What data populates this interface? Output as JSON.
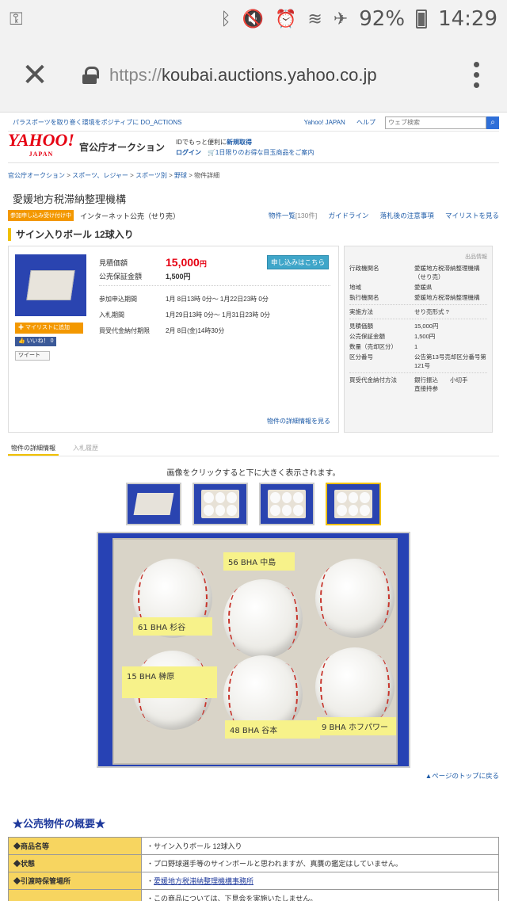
{
  "statusbar": {
    "battery": "92%",
    "time": "14:29",
    "icons": [
      "key-icon",
      "bluetooth-icon",
      "mute-icon",
      "alarm-icon",
      "wifi-icon",
      "airplane-icon",
      "battery-icon"
    ]
  },
  "browser": {
    "url_proto": "https://",
    "url_host": "koubai.auctions.yahoo.co.jp"
  },
  "top": {
    "promo": "パラスポーツを取り巻く環境をポジティブに DO_ACTIONS",
    "yahoo_japan_link": "Yahoo! JAPAN",
    "help_link": "ヘルプ",
    "search_placeholder": "ウェブ検索"
  },
  "header": {
    "logo_main": "YAHOO!",
    "logo_sub": "JAPAN",
    "site_name": "官公庁オークション",
    "msg_line1_prefix": "IDでもっと便利に",
    "msg_line1_link": "新規取得",
    "msg_line2_link": "ログイン",
    "msg_line2_text": "🛒1日限りのお得な目玉商品をご案内"
  },
  "breadcrumb": {
    "items": [
      "官公庁オークション",
      "スポーツ、レジャー",
      "スポーツ別",
      "野球"
    ],
    "current": "物件詳細",
    "sep": " > "
  },
  "org_title": "愛媛地方税滞納整理機構",
  "status": {
    "badge": "参加申し込み受け付け中",
    "type": "インターネット公売（せり売）",
    "links": {
      "list": "物件一覧",
      "list_count": "[130件]",
      "guideline": "ガイドライン",
      "notice": "落札後の注意事項",
      "mylist": "マイリストを見る"
    }
  },
  "item_title": "サイン入りボール 12球入り",
  "left": {
    "mylist_btn": "✚ マイリストに追加",
    "fb_like": "👍 いいね！ 0",
    "tweet": "ツイート",
    "price_label": "見積価額",
    "price_value": "15,000",
    "price_unit": "円",
    "apply_btn": "申し込みはこちら",
    "deposit_label": "公売保証金額",
    "deposit_value": "1,500円",
    "periods": [
      {
        "label": "参加申込期間",
        "value": "1月 8日13時 0分〜 1月22日23時 0分"
      },
      {
        "label": "入札期間",
        "value": "1月29日13時 0分〜 1月31日23時 0分"
      },
      {
        "label": "買受代金納付期限",
        "value": "2月 8日(金)14時30分"
      }
    ],
    "more_link": "物件の詳細情報を見る"
  },
  "right": {
    "caption": "出品情報",
    "rows1": [
      {
        "k": "行政機関名",
        "v": "愛媛地方税滞納整理機構（せり売）"
      },
      {
        "k": "地域",
        "v": "愛媛県"
      },
      {
        "k": "執行機関名",
        "v": "愛媛地方税滞納整理機構"
      }
    ],
    "rows2": [
      {
        "k": "実施方法",
        "v": "せり売形式 ?"
      }
    ],
    "rows3": [
      {
        "k": "見積価額",
        "v": "15,000円"
      },
      {
        "k": "公売保証金額",
        "v": "1,500円"
      },
      {
        "k": "数量（売却区分）",
        "v": "1"
      },
      {
        "k": "区分番号",
        "v": "公告第13号売却区分番号第121号"
      }
    ],
    "rows4": [
      {
        "k": "買受代金納付方法",
        "v": "銀行振込　　小切手\n直接持参"
      }
    ]
  },
  "tabs": [
    {
      "label": "物件の詳細情報",
      "active": true
    },
    {
      "label": "入札履歴",
      "active": false
    }
  ],
  "gallery": {
    "caption": "画像をクリックすると下に大きく表示されます。"
  },
  "photo": {
    "notes": [
      {
        "text": "56 BHA 中島"
      },
      {
        "text": "61 BHA 杉谷"
      },
      {
        "text": "15 BHA 榊原"
      },
      {
        "text": "48 BHA 谷本"
      },
      {
        "text": "9 BHA ホフパワー"
      }
    ]
  },
  "page_top": "▲ページのトップに戻る",
  "summary": {
    "heading": "★公売物件の概要★",
    "rows": [
      {
        "k": "◆商品名等",
        "v": "・サイン入りボール 12球入り",
        "link": false
      },
      {
        "k": "◆状態",
        "v": "・プロ野球選手等のサインボールと思われますが、真贋の鑑定はしていません。",
        "link": false
      },
      {
        "k": "◆引渡時保管場所",
        "v": "愛媛地方税滞納整理機構事務所",
        "prefix": "・",
        "link": true
      },
      {
        "k": "",
        "v": "・この商品については、下見会を実施いたしません。\n　下見をご希望の方は、参加申込期間の平日執務時間中（午前9時〜午後4時）に限り、ご連絡を",
        "link": false
      }
    ]
  }
}
